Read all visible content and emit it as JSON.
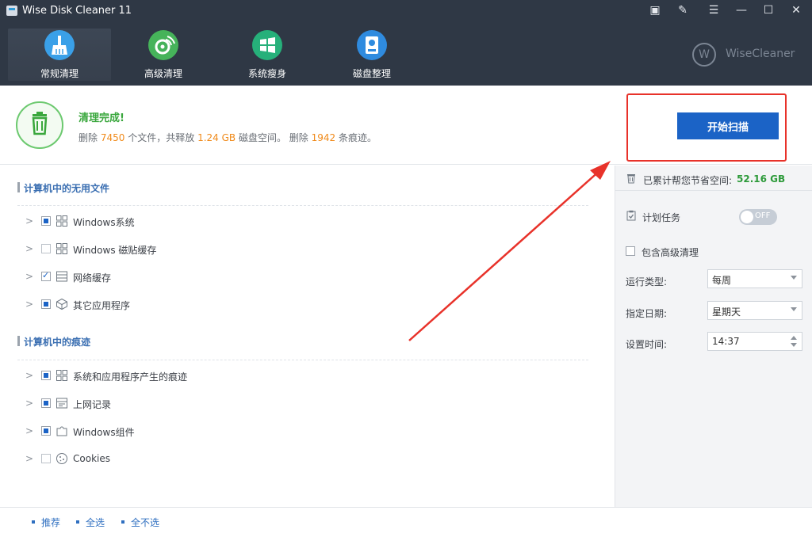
{
  "window": {
    "title": "Wise Disk Cleaner 11",
    "controls": [
      "▣",
      "✎",
      "☰",
      "—",
      "☐",
      "✕"
    ]
  },
  "nav": {
    "tabs": [
      {
        "label": "常规清理",
        "icon": "broom-icon",
        "color": "#3aa0e8",
        "active": true
      },
      {
        "label": "高级清理",
        "icon": "radar-icon",
        "color": "#46b35a",
        "active": false
      },
      {
        "label": "系统瘦身",
        "icon": "windows-icon",
        "color": "#26b07a",
        "active": false
      },
      {
        "label": "磁盘整理",
        "icon": "disk-icon",
        "color": "#2f8bdf",
        "active": false
      }
    ],
    "brand": "WiseCleaner"
  },
  "status": {
    "title": "清理完成!",
    "line_prefix": "删除",
    "files_count": "7450",
    "files_text": "个文件，共释放",
    "freed_size": "1.24 GB",
    "freed_text": "磁盘空间。 删除",
    "traces_count": "1942",
    "traces_text": "条痕迹。",
    "scan_button": "开始扫描"
  },
  "sections": [
    {
      "title": "计算机中的无用文件",
      "items": [
        {
          "label": "Windows系统",
          "check": "partial",
          "icon": "windows-grid-icon"
        },
        {
          "label": "Windows 磁贴缓存",
          "check": "empty",
          "icon": "tiles-icon"
        },
        {
          "label": "网络缓存",
          "check": "checked",
          "icon": "network-cache-icon"
        },
        {
          "label": "其它应用程序",
          "check": "partial",
          "icon": "package-icon"
        }
      ]
    },
    {
      "title": "计算机中的痕迹",
      "items": [
        {
          "label": "系统和应用程序产生的痕迹",
          "check": "partial",
          "icon": "windows-grid-icon"
        },
        {
          "label": "上网记录",
          "check": "partial",
          "icon": "browser-history-icon"
        },
        {
          "label": "Windows组件",
          "check": "partial",
          "icon": "puzzle-icon"
        },
        {
          "label": "Cookies",
          "check": "empty",
          "icon": "cookie-icon"
        }
      ]
    }
  ],
  "right_panel": {
    "saved_label": "已累计帮您节省空间:",
    "saved_value": "52.16 GB",
    "schedule_label": "计划任务",
    "toggle_text": "OFF",
    "include_advanced": "包含高级清理",
    "run_type_label": "运行类型:",
    "run_type_value": "每周",
    "date_label": "指定日期:",
    "date_value": "星期天",
    "time_label": "设置时间:",
    "time_value": "14:37"
  },
  "footer": {
    "links": [
      "推荐",
      "全选",
      "全不选"
    ]
  },
  "colors": {
    "header_bg": "#2f38454",
    "accent_blue": "#1b63c6",
    "success_green": "#3aa73d",
    "number_orange": "#f08a1a",
    "annotation_red": "#e8322a"
  }
}
